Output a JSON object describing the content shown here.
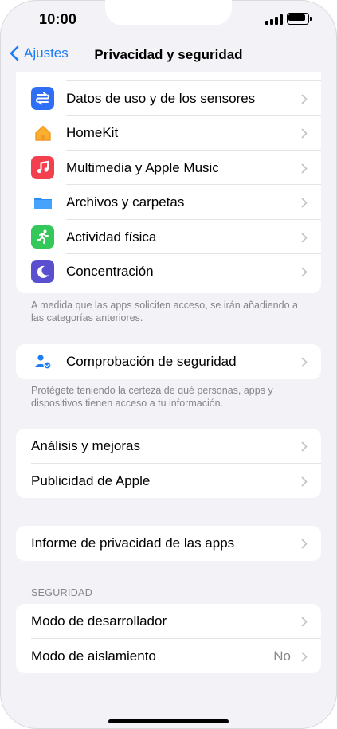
{
  "status_bar": {
    "time": "10:00"
  },
  "nav": {
    "back_label": "Ajustes",
    "title": "Privacidad y seguridad"
  },
  "privacy_list": {
    "items": [
      {
        "label": "Datos de uso y de los sensores",
        "icon": "sensor-data-icon",
        "color": "#2f6ff5"
      },
      {
        "label": "HomeKit",
        "icon": "home-icon",
        "color": "#ffffff"
      },
      {
        "label": "Multimedia y Apple Music",
        "icon": "music-note-icon",
        "color": "#f2404f"
      },
      {
        "label": "Archivos y carpetas",
        "icon": "folder-icon",
        "color": "#ffffff"
      },
      {
        "label": "Actividad física",
        "icon": "fitness-runner-icon",
        "color": "#34c759"
      },
      {
        "label": "Concentración",
        "icon": "moon-icon",
        "color": "#5a4fcf"
      }
    ],
    "footnote": "A medida que las apps soliciten acceso, se irán añadiendo a las categorías anteriores."
  },
  "safety_check": {
    "label": "Comprobación de seguridad",
    "icon": "person-check-icon",
    "footnote": "Protégete teniendo la certeza de qué personas, apps y dispositivos tienen acceso a tu información."
  },
  "analytics": {
    "items": [
      {
        "label": "Análisis y mejoras"
      },
      {
        "label": "Publicidad de Apple"
      }
    ]
  },
  "app_privacy_report": {
    "label": "Informe de privacidad de las apps"
  },
  "security": {
    "header": "SEGURIDAD",
    "items": [
      {
        "label": "Modo de desarrollador",
        "value": ""
      },
      {
        "label": "Modo de aislamiento",
        "value": "No"
      }
    ]
  },
  "colors": {
    "accent": "#1b7cf4",
    "background": "#f2f2f7"
  }
}
